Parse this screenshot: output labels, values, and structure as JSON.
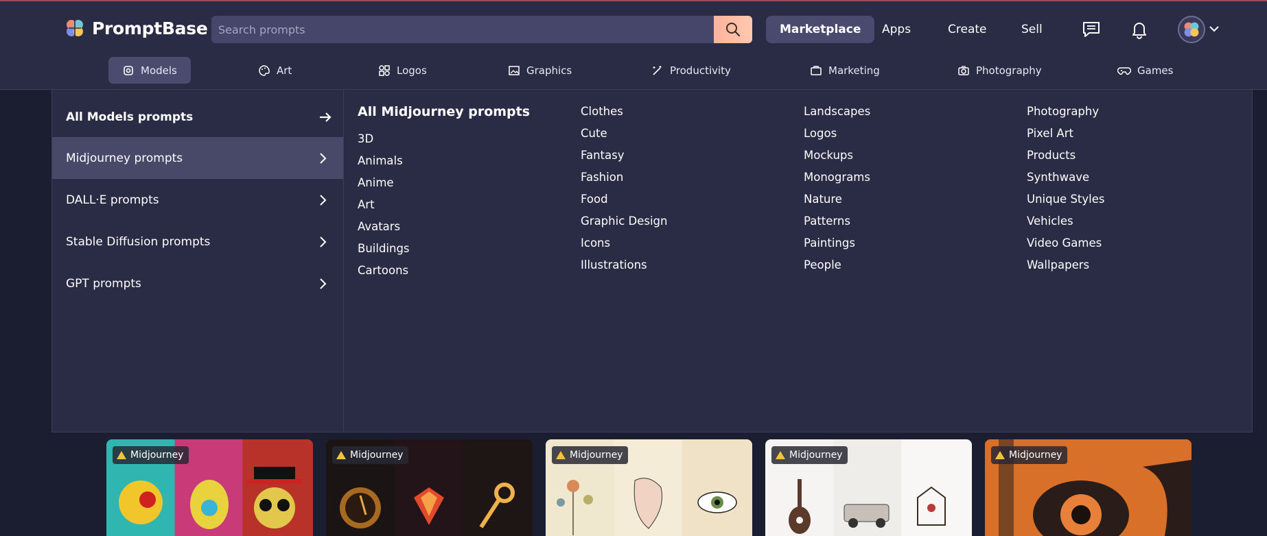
{
  "header": {
    "brand": "PromptBase",
    "search": {
      "placeholder": "Search prompts",
      "value": ""
    },
    "nav": [
      "Marketplace",
      "Apps",
      "Create",
      "Sell"
    ],
    "active_nav": "Marketplace"
  },
  "categories": [
    {
      "label": "Models",
      "icon": "models-icon",
      "active": true
    },
    {
      "label": "Art",
      "icon": "palette-icon"
    },
    {
      "label": "Logos",
      "icon": "shapes-icon"
    },
    {
      "label": "Graphics",
      "icon": "image-icon"
    },
    {
      "label": "Productivity",
      "icon": "magic-wand-icon"
    },
    {
      "label": "Marketing",
      "icon": "briefcase-icon"
    },
    {
      "label": "Photography",
      "icon": "camera-icon"
    },
    {
      "label": "Games",
      "icon": "gamepad-icon"
    }
  ],
  "dropdown": {
    "all_label": "All Models prompts",
    "models": [
      {
        "label": "Midjourney prompts",
        "active": true
      },
      {
        "label": "DALL·E prompts"
      },
      {
        "label": "Stable Diffusion prompts"
      },
      {
        "label": "GPT prompts"
      }
    ],
    "submenu_title": "All Midjourney prompts",
    "columns": [
      [
        "3D",
        "Animals",
        "Anime",
        "Art",
        "Avatars",
        "Buildings",
        "Cartoons"
      ],
      [
        "Clothes",
        "Cute",
        "Fantasy",
        "Fashion",
        "Food",
        "Graphic Design",
        "Icons",
        "Illustrations"
      ],
      [
        "Landscapes",
        "Logos",
        "Mockups",
        "Monograms",
        "Nature",
        "Patterns",
        "Paintings",
        "People"
      ],
      [
        "Photography",
        "Pixel Art",
        "Products",
        "Synthwave",
        "Unique Styles",
        "Vehicles",
        "Video Games",
        "Wallpapers"
      ]
    ]
  },
  "cards": [
    {
      "badge": "Midjourney"
    },
    {
      "badge": "Midjourney"
    },
    {
      "badge": "Midjourney"
    },
    {
      "badge": "Midjourney"
    },
    {
      "badge": "Midjourney"
    }
  ],
  "colors": {
    "background": "#1b1d30",
    "header": "#2a2b44",
    "active": "#4a4b6f",
    "search_button": "#ffbba3",
    "badge_icon": "#f3c23b"
  }
}
